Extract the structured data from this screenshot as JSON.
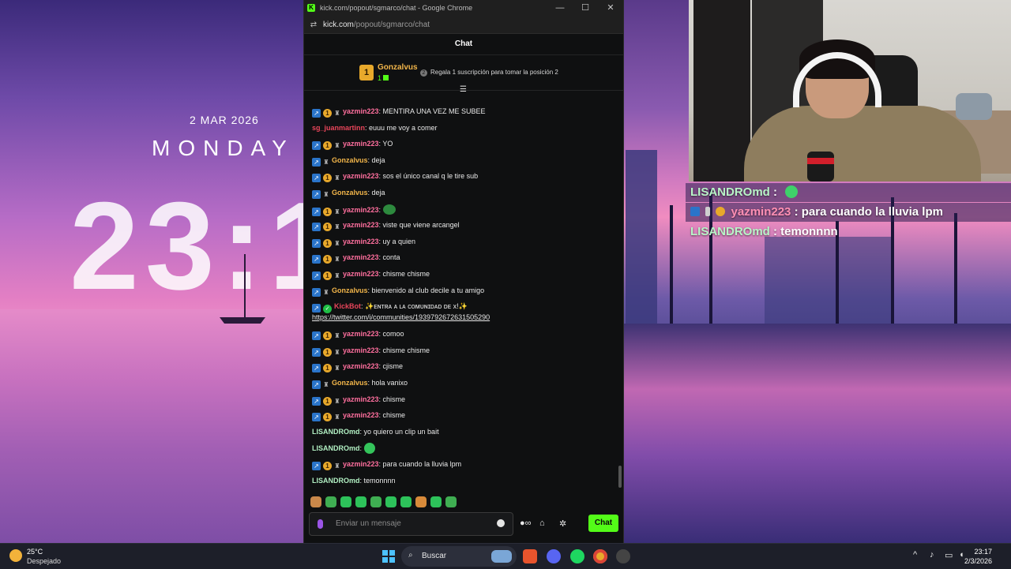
{
  "wallpaper": {
    "date": "2 MAR 2026",
    "day": "MONDAY",
    "time": "23:1"
  },
  "window": {
    "title": "kick.com/popout/sgmarco/chat - Google Chrome",
    "url_host": "kick.com",
    "url_path": "/popout/sgmarco/chat",
    "controls": {
      "minimize": "—",
      "maximize": "☐",
      "close": "✕"
    }
  },
  "chat": {
    "header": "Chat",
    "pinned": {
      "rank": "1",
      "name": "Gonzalvus",
      "count": "1",
      "hint_icon": "2",
      "hint": "Regala 1 suscripción para tomar la posición 2"
    },
    "messages": [
      {
        "user": "yazmin223",
        "text": ": MENTIRA UNA VEZ ME SUBEE",
        "style": "pink",
        "badges": [
          "sub",
          "coin",
          "trophy"
        ]
      },
      {
        "user": "sg_juanmartinn",
        "text": ": euuu me voy a comer",
        "style": "red",
        "badges": []
      },
      {
        "user": "yazmin223",
        "text": ": YO",
        "style": "pink",
        "badges": [
          "sub",
          "coin",
          "trophy"
        ]
      },
      {
        "user": "Gonzalvus",
        "text": ": deja",
        "style": "gold",
        "badges": [
          "sub",
          "trophy"
        ]
      },
      {
        "user": "yazmin223",
        "text": ": sos el único canal q le tire sub",
        "style": "pink",
        "badges": [
          "sub",
          "coin",
          "trophy"
        ]
      },
      {
        "user": "Gonzalvus",
        "text": ": deja",
        "style": "gold",
        "badges": [
          "sub",
          "trophy"
        ]
      },
      {
        "user": "yazmin223",
        "text": ": ",
        "style": "pink",
        "badges": [
          "sub",
          "coin",
          "trophy"
        ],
        "emote": "frog"
      },
      {
        "user": "yazmin223",
        "text": ": viste que viene arcangel",
        "style": "pink",
        "badges": [
          "sub",
          "coin",
          "trophy"
        ]
      },
      {
        "user": "yazmin223",
        "text": ": uy a quien",
        "style": "pink",
        "badges": [
          "sub",
          "coin",
          "trophy"
        ]
      },
      {
        "user": "yazmin223",
        "text": ": conta",
        "style": "pink",
        "badges": [
          "sub",
          "coin",
          "trophy"
        ]
      },
      {
        "user": "yazmin223",
        "text": ": chisme chisme",
        "style": "pink",
        "badges": [
          "sub",
          "coin",
          "trophy"
        ]
      },
      {
        "user": "Gonzalvus",
        "text": ": bienvenido al club decile a tu amigo",
        "style": "gold",
        "badges": [
          "sub",
          "trophy"
        ]
      },
      {
        "user": "KickBot",
        "text": ": ✨ᴇɴᴛʀᴀ ᴀ ʟᴀ ᴄᴏᴍᴜɴɪᴅᴀᴅ ᴅᴇ x!✨",
        "style": "bot",
        "badges": [
          "sub",
          "verified"
        ],
        "link": "https://twitter.com/i/communities/1939792672631505290"
      },
      {
        "user": "yazmin223",
        "text": ": comoo",
        "style": "pink",
        "badges": [
          "sub",
          "coin",
          "trophy"
        ]
      },
      {
        "user": "yazmin223",
        "text": ": chisme chisme",
        "style": "pink",
        "badges": [
          "sub",
          "coin",
          "trophy"
        ]
      },
      {
        "user": "yazmin223",
        "text": ": cjisme",
        "style": "pink",
        "badges": [
          "sub",
          "coin",
          "trophy"
        ]
      },
      {
        "user": "Gonzalvus",
        "text": ": hola vanixo",
        "style": "gold",
        "badges": [
          "sub",
          "trophy"
        ]
      },
      {
        "user": "yazmin223",
        "text": ": chisme",
        "style": "pink",
        "badges": [
          "sub",
          "coin",
          "trophy"
        ]
      },
      {
        "user": "yazmin223",
        "text": ": chisme",
        "style": "pink",
        "badges": [
          "sub",
          "coin",
          "trophy"
        ]
      },
      {
        "user": "LISANDROmd",
        "text": ": yo quiero un clip un bait",
        "style": "green",
        "badges": []
      },
      {
        "user": "LISANDROmd",
        "text": ": ",
        "style": "green",
        "badges": [],
        "emote": "green"
      },
      {
        "user": "yazmin223",
        "text": ": para cuando la lluvia lpm",
        "style": "pink",
        "badges": [
          "sub",
          "coin",
          "trophy"
        ]
      },
      {
        "user": "LISANDROmd",
        "text": ": temonnnn",
        "style": "green",
        "badges": []
      }
    ],
    "input_placeholder": "Enviar un mensaje",
    "send_label": "Chat",
    "colors": {
      "accent": "#53fc18",
      "pink_user": "#ff6f9e",
      "gold_user": "#f3b64a"
    }
  },
  "overlay": {
    "rows": [
      {
        "user": "LISANDROmd",
        "text": " :",
        "emote": true
      },
      {
        "user": "yazmin223",
        "text": " : para cuando la lluvia lpm",
        "badges": true
      },
      {
        "user": "LISANDROmd",
        "text": " : temonnnn"
      }
    ]
  },
  "taskbar": {
    "weather_temp": "25°C",
    "weather_desc": "Despejado",
    "search_label": "Buscar",
    "time": "23:17",
    "date": "2/3/2026",
    "tray_chevron": "^"
  }
}
